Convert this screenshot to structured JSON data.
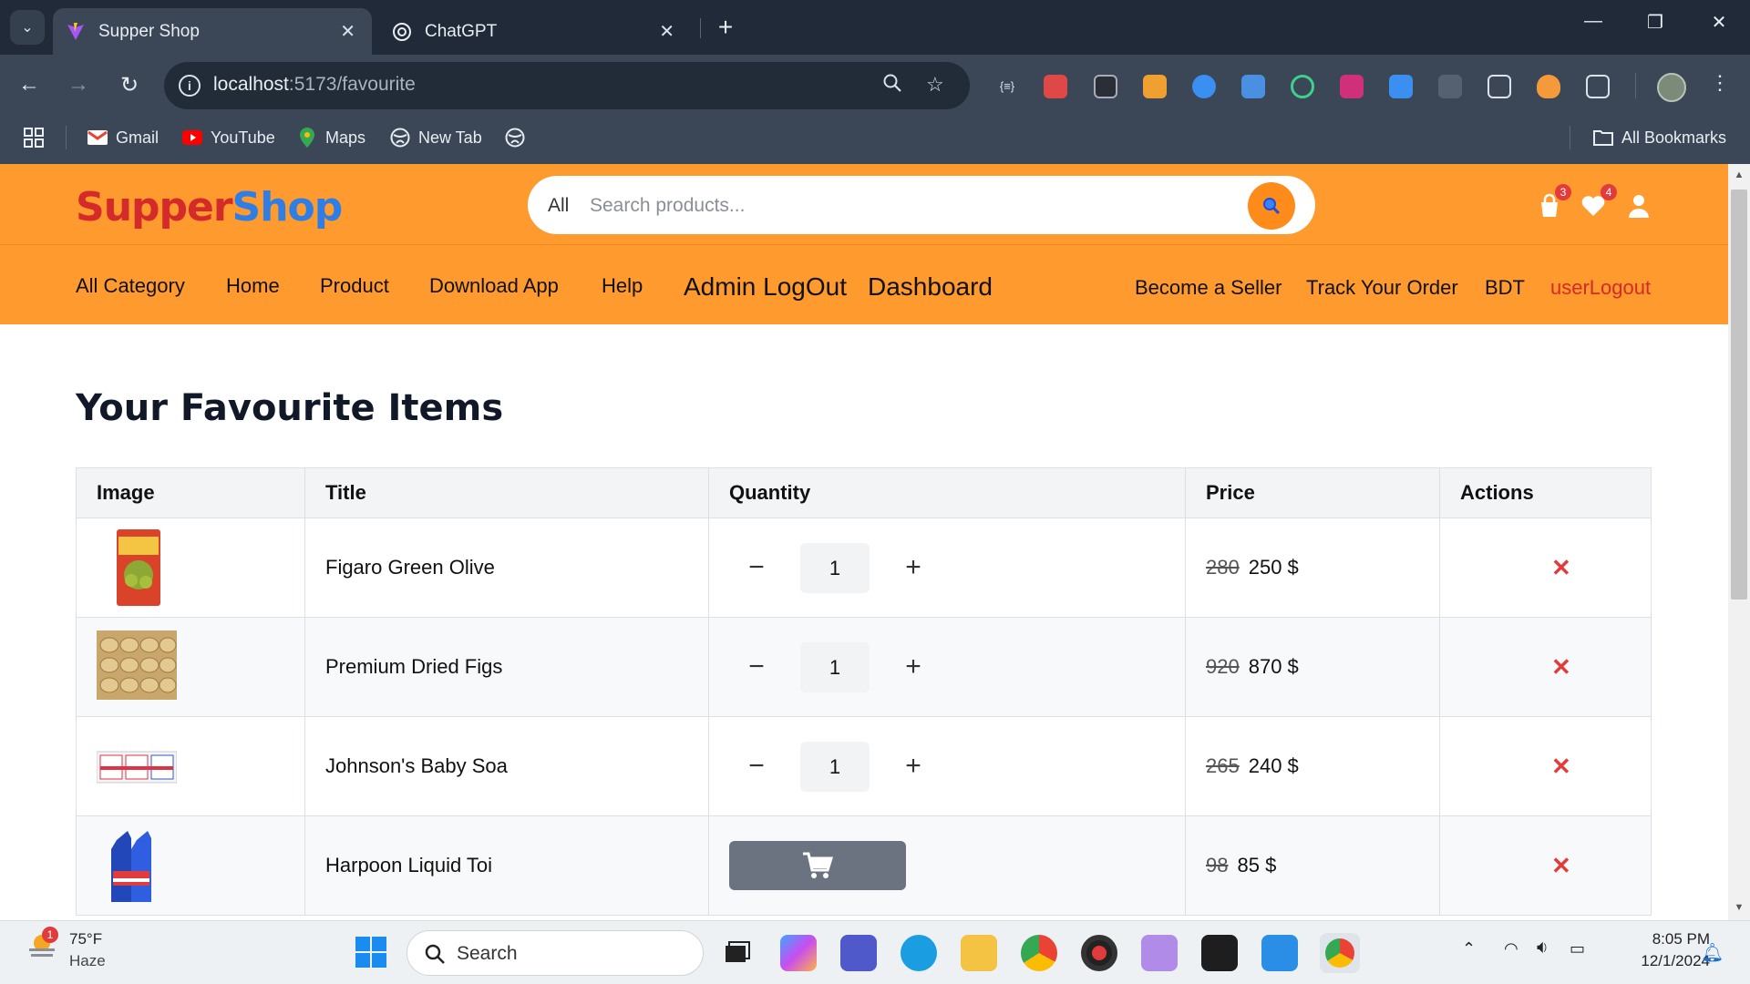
{
  "browser": {
    "tabs": [
      {
        "title": "Supper Shop",
        "active": true
      },
      {
        "title": "ChatGPT",
        "active": false
      }
    ],
    "url_host": "localhost",
    "url_path": ":5173/favourite",
    "bookmarks": [
      "Gmail",
      "YouTube",
      "Maps",
      "New Tab"
    ],
    "all_bookmarks": "All Bookmarks"
  },
  "header": {
    "logo_part1": "Supper",
    "logo_part2": "Shop",
    "search_scope": "All",
    "search_placeholder": "Search products...",
    "cart_count": "3",
    "wishlist_count": "4"
  },
  "nav": {
    "items": [
      "All Category",
      "Home",
      "Product",
      "Download App",
      "Help"
    ],
    "admin_logout": "Admin LogOut",
    "dashboard": "Dashboard",
    "right": [
      "Become a Seller",
      "Track Your Order",
      "BDT"
    ],
    "user_logout": "userLogout"
  },
  "page": {
    "title": "Your Favourite Items",
    "columns": [
      "Image",
      "Title",
      "Quantity",
      "Price",
      "Actions"
    ],
    "rows": [
      {
        "title": "Figaro Green Olive",
        "qty": "1",
        "old_price": "280",
        "price": "250 $",
        "in_cart": true
      },
      {
        "title": "Premium Dried Figs",
        "qty": "1",
        "old_price": "920",
        "price": "870 $",
        "in_cart": true
      },
      {
        "title": "Johnson's Baby Soa",
        "qty": "1",
        "old_price": "265",
        "price": "240 $",
        "in_cart": true
      },
      {
        "title": "Harpoon Liquid Toi",
        "qty": "",
        "old_price": "98",
        "price": "85 $",
        "in_cart": false
      }
    ],
    "qty_minus": "−",
    "qty_plus": "+",
    "delete_symbol": "✕"
  },
  "taskbar": {
    "weather_temp": "75°F",
    "weather_cond": "Haze",
    "weather_badge": "1",
    "search_label": "Search",
    "time": "8:05 PM",
    "date": "12/1/2024"
  },
  "colors": {
    "header_bg": "#ff9a2e",
    "logo_red": "#d42a2a",
    "logo_blue": "#2f7ee6",
    "delete_red": "#e23b3b"
  }
}
